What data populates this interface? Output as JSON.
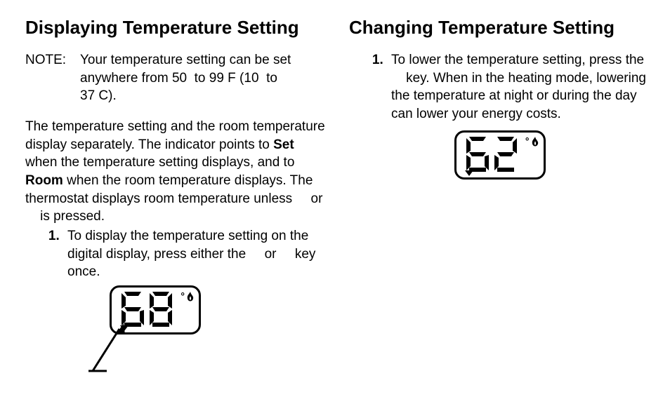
{
  "left": {
    "title": "Displaying Temperature Setting",
    "note_label": "NOTE:",
    "note_body": "Your temperature setting can be set anywhere from 50  to 99 F (10  to 37 C).",
    "paragraph_parts": {
      "a": "The temperature setting and the room temperature display separately. The indicator points to ",
      "b_set": "Set",
      "c": " when the temperature setting displays, and to ",
      "d_room": "Room",
      "e": " when the room temperature displays. The thermostat displays room temperature unless     or     is pressed."
    },
    "step1": "To display the temperature setting on the digital display, press either the     or     key once.",
    "lcd_value": "68",
    "lcd_deg": "°"
  },
  "right": {
    "title": "Changing Temperature Setting",
    "step1": "To lower the temperature setting, press the     key. When in the heating mode, lowering the temperature at night or during the day can lower your energy costs.",
    "lcd_value": "62",
    "lcd_deg": "°"
  }
}
